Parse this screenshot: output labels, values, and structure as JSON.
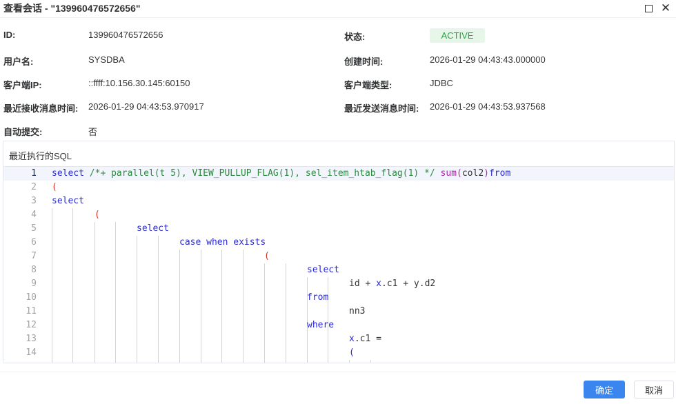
{
  "dialog": {
    "title": "查看会话 - \"139960476572656\"",
    "maximize_icon": "maximize-icon",
    "close_icon": "close-icon"
  },
  "info": {
    "id_label": "ID:",
    "id_value": "139960476572656",
    "status_label": "状态:",
    "status_value": "ACTIVE",
    "user_label": "用户名:",
    "user_value": "SYSDBA",
    "created_label": "创建时间:",
    "created_value": "2026-01-29 04:43:43.000000",
    "client_ip_label": "客户端IP:",
    "client_ip_value": "::ffff:10.156.30.145:60150",
    "client_type_label": "客户端类型:",
    "client_type_value": "JDBC",
    "last_recv_label": "最近接收消息时间:",
    "last_recv_value": "2026-01-29 04:43:53.970917",
    "last_send_label": "最近发送消息时间:",
    "last_send_value": "2026-01-29 04:43:53.937568",
    "autocommit_label": "自动提交:",
    "autocommit_value": "否"
  },
  "sql": {
    "title": "最近执行的SQL",
    "line_numbers": [
      "1",
      "2",
      "3",
      "4",
      "5",
      "6",
      "7",
      "8",
      "9",
      "10",
      "11",
      "12",
      "13",
      "14"
    ],
    "line1": {
      "kw_select": "select",
      "comment": "/*+ parallel(t 5), VIEW_PULLUP_FLAG(1), sel_item_htab_flag(1) */",
      "fn_sum": "sum",
      "paren_open": "(",
      "arg": "col2",
      "paren_close": ")",
      "kw_from": "from"
    },
    "line2": "(",
    "line3": "select",
    "line4": "(",
    "line5": "select",
    "line6": "case when exists",
    "line7": "(",
    "line8": "select",
    "line9": {
      "a": "id + ",
      "b": "x",
      "c": ".c1 + y.d2"
    },
    "line10": "from",
    "line11": "nn3",
    "line12": "where",
    "line13": {
      "a": "x",
      "b": ".c1 ="
    },
    "line14": "("
  },
  "footer": {
    "ok_label": "确定",
    "cancel_label": "取消"
  }
}
